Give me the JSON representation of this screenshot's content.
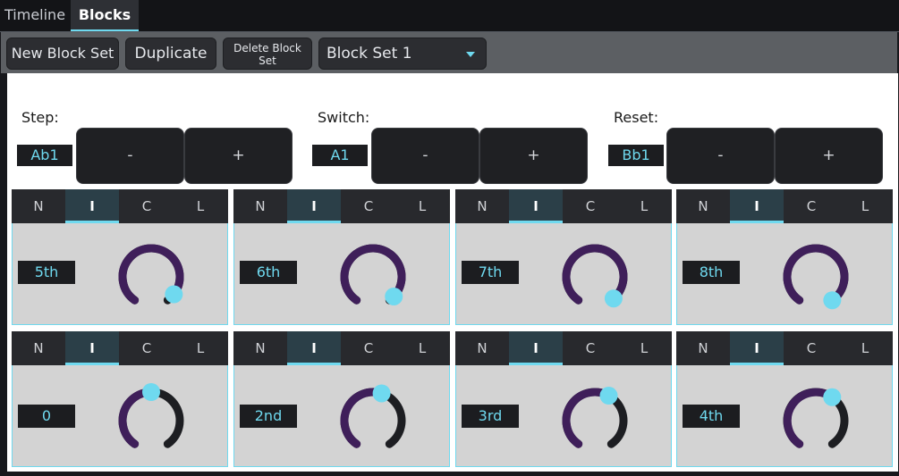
{
  "tabs": [
    {
      "label": "Timeline",
      "active": false
    },
    {
      "label": "Blocks",
      "active": true
    }
  ],
  "toolbar": {
    "new_label": "New Block Set",
    "duplicate_label": "Duplicate",
    "delete_label": "Delete Block Set",
    "selected_set": "Block Set 1"
  },
  "controls": [
    {
      "label": "Step:",
      "value": "Ab1",
      "minus": "-",
      "plus": "+"
    },
    {
      "label": "Switch:",
      "value": "A1",
      "minus": "-",
      "plus": "+"
    },
    {
      "label": "Reset:",
      "value": "Bb1",
      "minus": "-",
      "plus": "+"
    }
  ],
  "mode_buttons": [
    "N",
    "I",
    "C",
    "L"
  ],
  "active_mode": "I",
  "blocks": [
    {
      "label": "5th",
      "knob_value": 0.94
    },
    {
      "label": "6th",
      "knob_value": 0.96
    },
    {
      "label": "7th",
      "knob_value": 0.98
    },
    {
      "label": "8th",
      "knob_value": 1.0
    },
    {
      "label": "0",
      "knob_value": 0.5
    },
    {
      "label": "2nd",
      "knob_value": 0.56
    },
    {
      "label": "3rd",
      "knob_value": 0.6
    },
    {
      "label": "4th",
      "knob_value": 0.62
    }
  ],
  "colors": {
    "accent": "#6fd9ef",
    "knob_fill": "#3f1f5a",
    "knob_track": "#1d1e22",
    "panel_bg": "#ffffff",
    "block_bg": "#d3d3d3"
  }
}
